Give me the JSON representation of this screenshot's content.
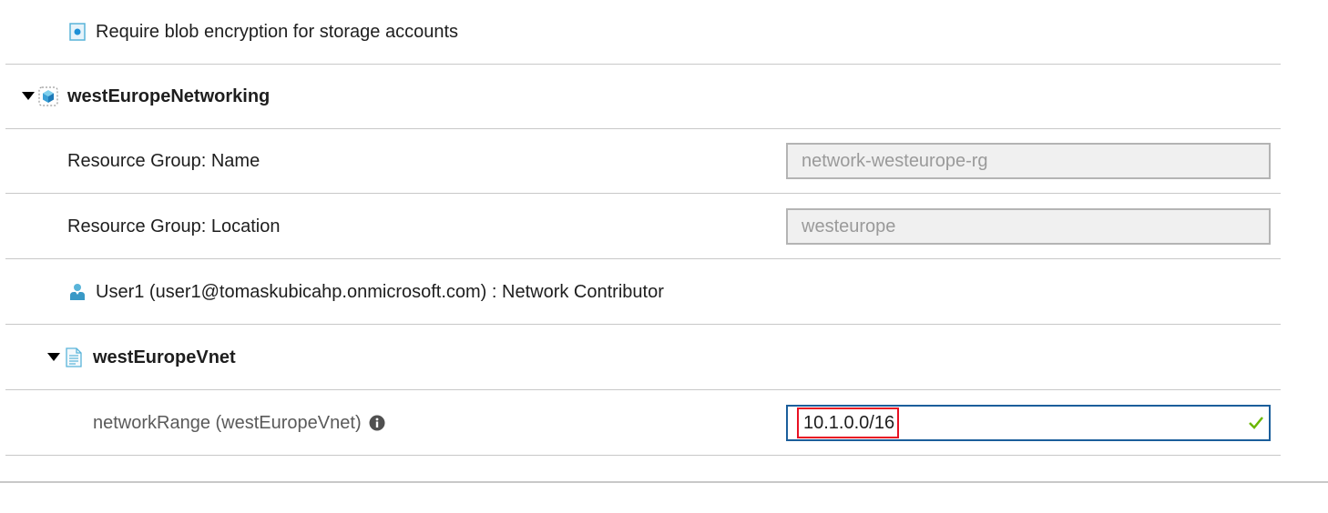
{
  "rows": {
    "policy": {
      "label": "Require blob encryption for storage accounts",
      "icon": "policy-icon"
    },
    "group": {
      "label": "westEuropeNetworking",
      "icon": "resource-group-icon"
    },
    "rg_name": {
      "label": "Resource Group: Name",
      "value": "network-westeurope-rg"
    },
    "rg_location": {
      "label": "Resource Group: Location",
      "value": "westeurope"
    },
    "user": {
      "label": "User1 (user1@tomaskubicahp.onmicrosoft.com) : Network Contributor",
      "icon": "user-icon"
    },
    "vnet": {
      "label": "westEuropeVnet",
      "icon": "template-icon"
    },
    "network_range": {
      "label": "networkRange (westEuropeVnet)",
      "value": "10.1.0.0/16",
      "icon": "info-icon",
      "status_icon": "checkmark-icon"
    }
  },
  "colors": {
    "accent": "#1b5e9b",
    "highlight_border": "#e81123",
    "valid": "#6bb700",
    "icon_blue": "#59b4d9"
  }
}
